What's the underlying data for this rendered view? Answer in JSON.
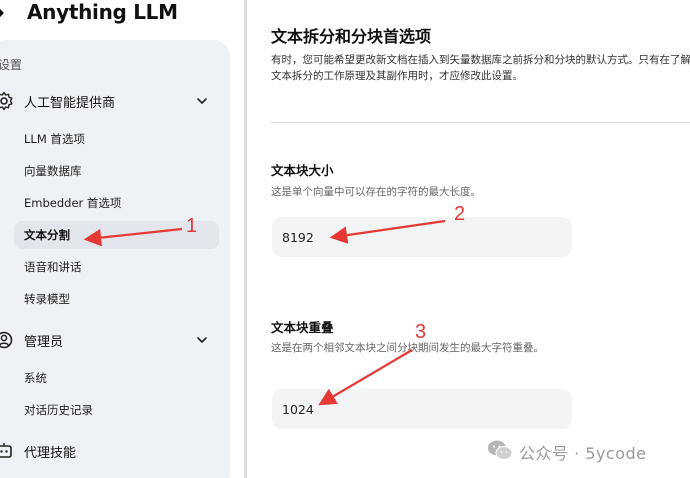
{
  "app": {
    "name": "Anything LLM"
  },
  "sidebar": {
    "section_label": "设置",
    "groups": [
      {
        "label": "人工智能提供商",
        "icon": "gear-icon",
        "items": [
          {
            "label": "LLM 首选项"
          },
          {
            "label": "向量数据库"
          },
          {
            "label": "Embedder 首选项"
          },
          {
            "label": "文本分割",
            "active": true
          },
          {
            "label": "语音和讲话"
          },
          {
            "label": "转录模型"
          }
        ]
      },
      {
        "label": "管理员",
        "icon": "admin-icon",
        "items": [
          {
            "label": "系统"
          },
          {
            "label": "对话历史记录"
          }
        ]
      },
      {
        "label": "代理技能",
        "icon": "agent-icon",
        "items": []
      }
    ]
  },
  "main": {
    "title": "文本拆分和分块首选项",
    "description": "有时，您可能希望更改新文档在插入到矢量数据库之前拆分和分块的默认方式。只有在了解文本拆分的工作原理及其副作用时，才应修改此设置。",
    "chunk_size": {
      "title": "文本块大小",
      "help": "这是单个向量中可以存在的字符的最大长度。",
      "value": "8192"
    },
    "chunk_overlap": {
      "title": "文本块重叠",
      "help": "这是在两个相邻文本块之间分块期间发生的最大字符重叠。",
      "value": "1024"
    }
  },
  "annotations": {
    "color": "#e53935",
    "labels": [
      "1",
      "2",
      "3"
    ]
  },
  "watermark": {
    "text": "公众号 · 5ycode",
    "icon": "wechat-icon"
  },
  "colors": {
    "sidebar_bg": "#eef1f5",
    "active_item_bg": "#e2e6ec",
    "input_bg": "#f3f4f6",
    "annotation": "#e53935"
  }
}
